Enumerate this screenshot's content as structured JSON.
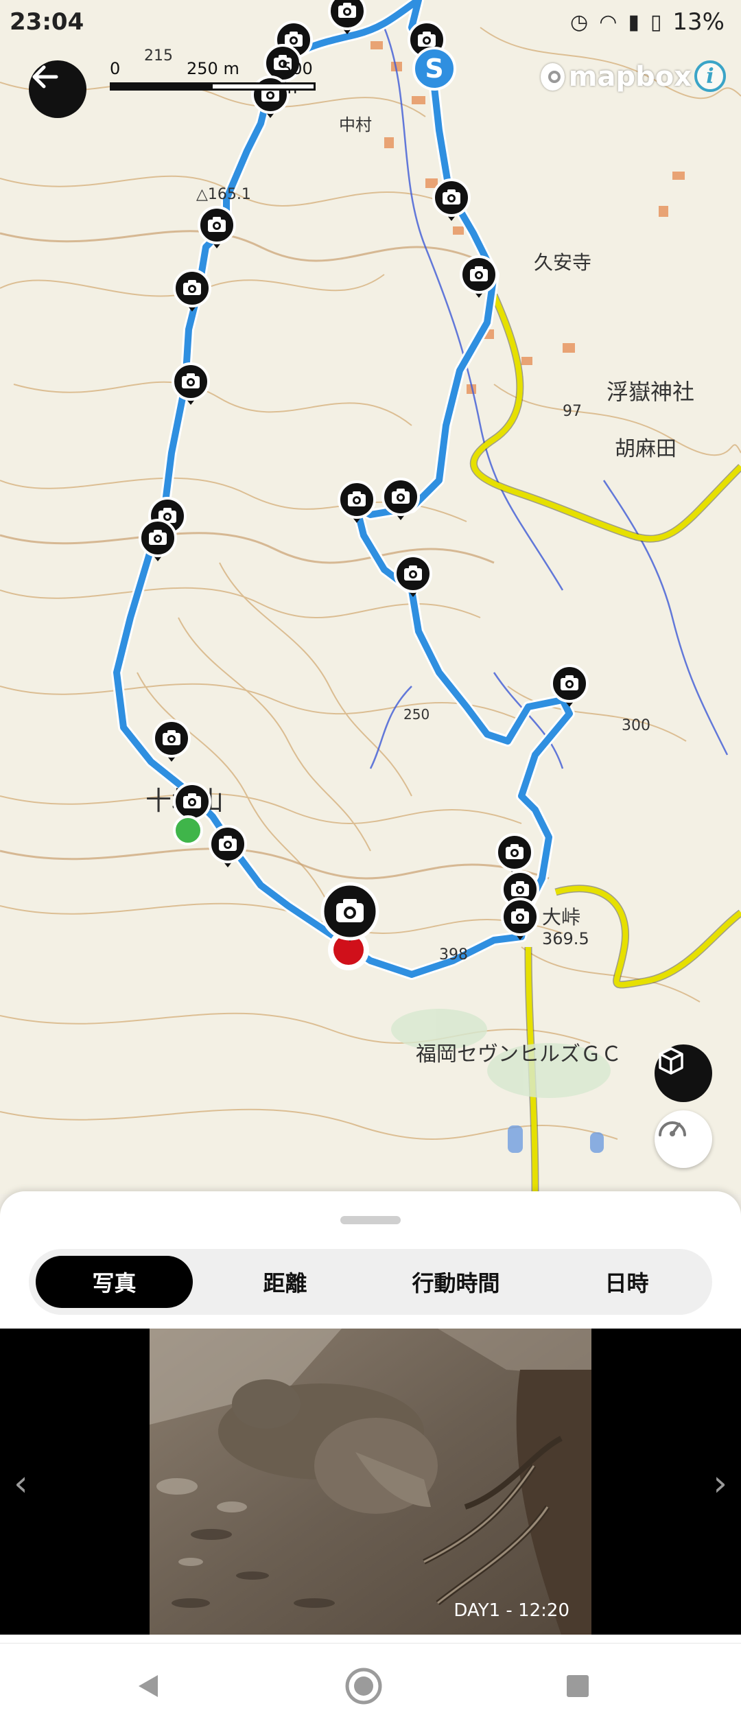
{
  "status_bar": {
    "time": "23:04",
    "battery": "13%"
  },
  "map": {
    "scale_labels": [
      "0",
      "250 m",
      "500 m"
    ],
    "attribution": "mapbox",
    "info_label": "i",
    "place_labels": [
      {
        "text": "久安寺"
      },
      {
        "text": "浮嶽神社"
      },
      {
        "text": "胡麻田"
      },
      {
        "text": "中村"
      },
      {
        "text": "福岡セヴンヒルズＧＣ"
      },
      {
        "text": "十坊山"
      },
      {
        "text": "大峠"
      },
      {
        "text": "369.5"
      },
      {
        "text": "398"
      },
      {
        "text": "300"
      },
      {
        "text": "250"
      },
      {
        "text": "215"
      },
      {
        "text": "97"
      },
      {
        "text": "△165.1"
      }
    ],
    "start_marker": "S"
  },
  "sheet": {
    "tabs": [
      {
        "label": "写真",
        "active": true
      },
      {
        "label": "距離",
        "active": false
      },
      {
        "label": "行動時間",
        "active": false
      },
      {
        "label": "日時",
        "active": false
      }
    ],
    "photo_caption": "DAY1 - 12:20",
    "prev_label": "‹",
    "next_label": "›"
  },
  "colors": {
    "route": "#2f8fe0",
    "road_yellow": "#e6e000",
    "current_marker": "#d0101a",
    "goal_marker": "#3fb54a"
  }
}
